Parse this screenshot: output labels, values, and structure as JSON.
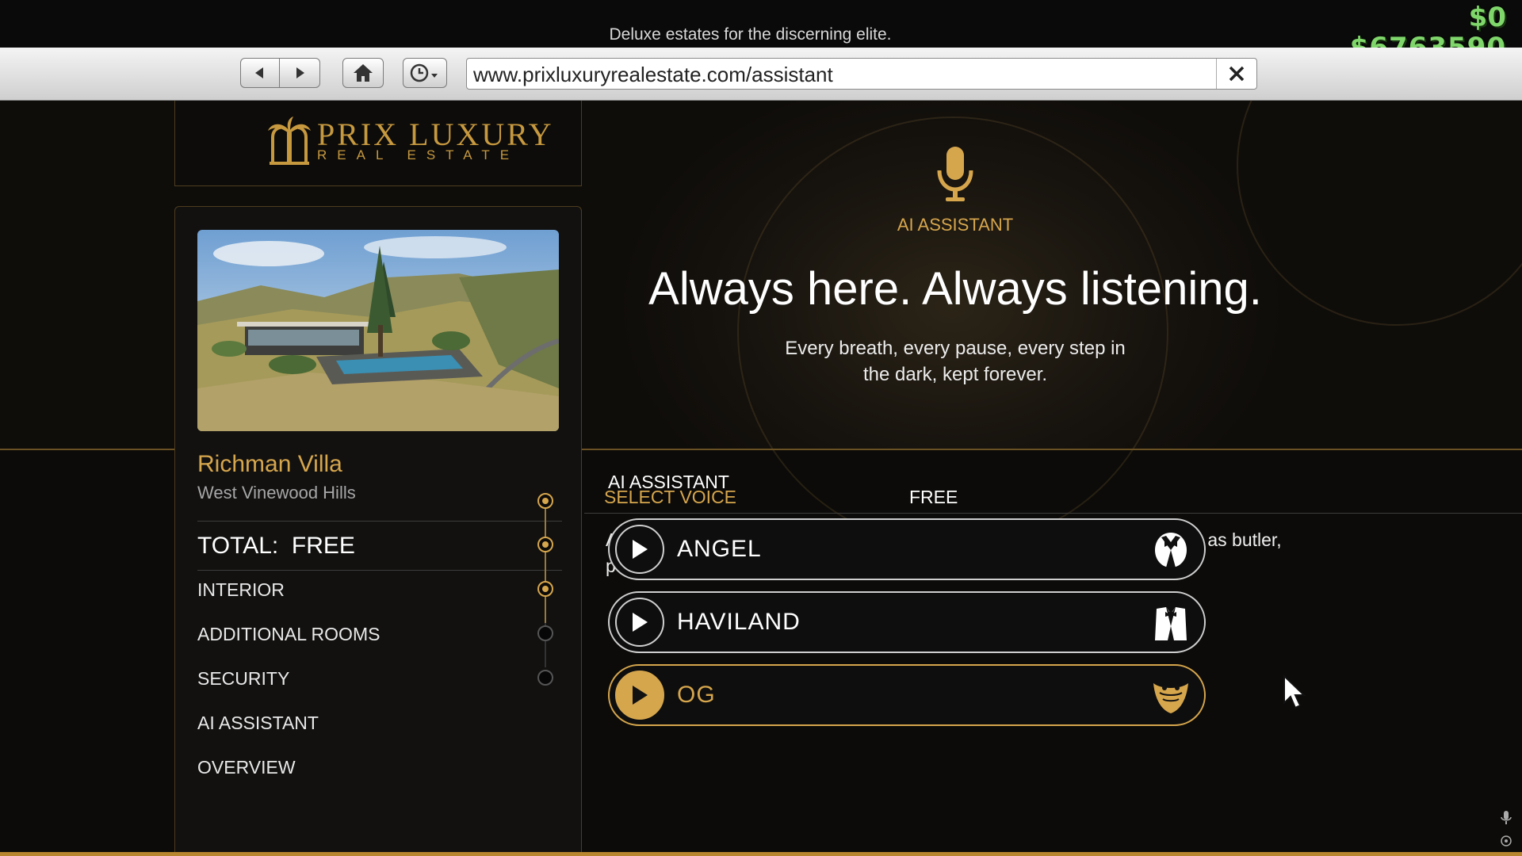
{
  "tagline": "Deluxe estates for the discerning elite.",
  "money": {
    "cash": "$0",
    "bank": "$6763590"
  },
  "browser": {
    "url": "www.prixluxuryrealestate.com/assistant"
  },
  "logo": {
    "line1": "PRIX LUXURY",
    "line2": "REAL ESTATE"
  },
  "property": {
    "name": "Richman Villa",
    "location": "West Vinewood Hills",
    "total_label": "TOTAL:",
    "total_value": "FREE"
  },
  "steps": [
    {
      "label": "INTERIOR",
      "done": true
    },
    {
      "label": "ADDITIONAL ROOMS",
      "done": true
    },
    {
      "label": "SECURITY",
      "done": true
    },
    {
      "label": "AI ASSISTANT",
      "done": false
    },
    {
      "label": "OVERVIEW",
      "done": false
    }
  ],
  "hero": {
    "label": "AI ASSISTANT",
    "title": "Always here. Always listening.",
    "subtitle_line1": "Every breath, every pause, every step in",
    "subtitle_line2": "the dark, kept forever."
  },
  "detail": {
    "heading": "AI ASSISTANT",
    "description": "A fully integrated AI system across all your mansions that balances its role as butler, personal assistant, and local entrepreneur.",
    "select_voice_label": "SELECT VOICE",
    "price": "FREE"
  },
  "voices": [
    {
      "name": "ANGEL",
      "icon": "tuxedo-icon",
      "selected": false
    },
    {
      "name": "HAVILAND",
      "icon": "butler-suit-icon",
      "selected": false
    },
    {
      "name": "OG",
      "icon": "bandana-icon",
      "selected": true
    }
  ],
  "colors": {
    "accent": "#d6a64d",
    "money": "#7fd66a",
    "page_bg": "#0c0b09"
  }
}
